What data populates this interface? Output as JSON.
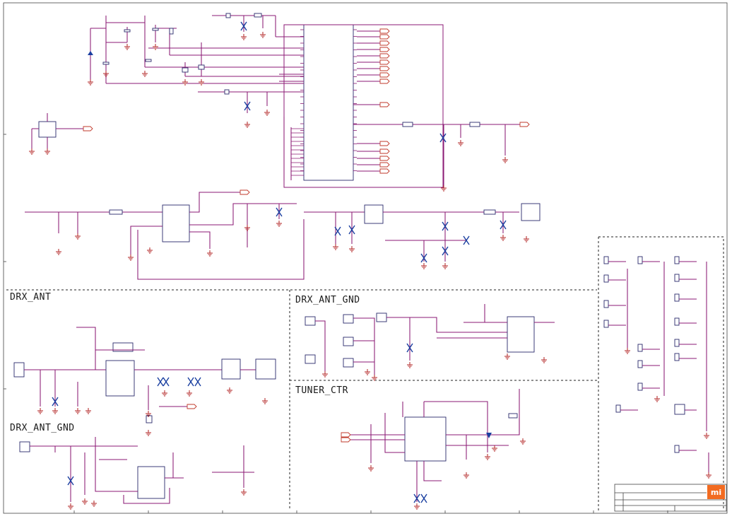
{
  "sections": {
    "drx_ant": "DRX_ANT",
    "drx_ant_gnd_left": "DRX_ANT_GND",
    "drx_ant_gnd_right": "DRX_ANT_GND",
    "tuner_ctr": "TUNER_CTR"
  },
  "logo": {
    "text": "mi",
    "color": "#f26b21"
  },
  "colors": {
    "wire": "#8b1a74",
    "component": "#2a2a6a",
    "ground": "#b22222",
    "no_connect": "#1a3fa0",
    "netlabel": "#c0392b"
  }
}
